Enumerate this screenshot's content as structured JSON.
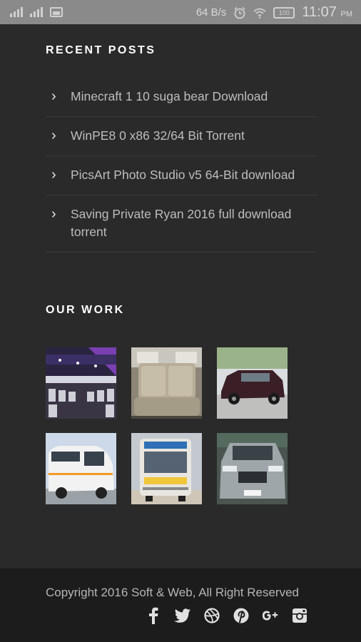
{
  "status_bar": {
    "speed": "64 B/s",
    "battery": "100",
    "time": "11:07",
    "ampm": "PM"
  },
  "recent_posts": {
    "title": "RECENT POSTS",
    "items": [
      {
        "label": "Minecraft 1 10 suga bear Download"
      },
      {
        "label": "WinPE8 0 x86 32/64 Bit Torrent"
      },
      {
        "label": "PicsArt Photo Studio v5 64-Bit download"
      },
      {
        "label": "Saving Private Ryan 2016 full download torrent"
      }
    ]
  },
  "our_work": {
    "title": "OUR WORK",
    "items": [
      {
        "name": "bus-interior-photo"
      },
      {
        "name": "car-seats-photo"
      },
      {
        "name": "maroon-suv-photo"
      },
      {
        "name": "white-van-photo"
      },
      {
        "name": "bus-front-photo"
      },
      {
        "name": "silver-car-front-photo"
      }
    ]
  },
  "footer": {
    "copyright": "Copyright 2016 Soft & Web, All Right Reserved",
    "social": [
      "facebook-icon",
      "twitter-icon",
      "dribbble-icon",
      "pinterest-icon",
      "google-plus-icon",
      "instagram-icon"
    ]
  }
}
